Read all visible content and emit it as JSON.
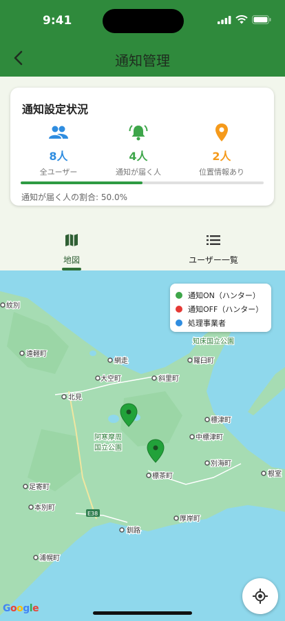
{
  "status_bar": {
    "time": "9:41"
  },
  "header": {
    "title": "通知管理"
  },
  "card": {
    "title": "通知設定状況",
    "stats": [
      {
        "value": "8人",
        "label": "全ユーザー",
        "icon": "group-icon",
        "color": "#2f8de0"
      },
      {
        "value": "4人",
        "label": "通知が届く人",
        "icon": "bell-icon",
        "color": "#3ea64a"
      },
      {
        "value": "2人",
        "label": "位置情報あり",
        "icon": "location-pin-icon",
        "color": "#f59a1b"
      }
    ],
    "progress": 0.5,
    "ratio_text": "通知が届く人の割合: 50.0%"
  },
  "tabs": [
    {
      "label": "地図",
      "icon": "map-icon",
      "selected": true
    },
    {
      "label": "ユーザー一覧",
      "icon": "list-icon",
      "selected": false
    }
  ],
  "legend": [
    {
      "label": "通知ON（ハンター）",
      "color": "#3ea64a"
    },
    {
      "label": "通知OFF（ハンター）",
      "color": "#e53935"
    },
    {
      "label": "処理事業者",
      "color": "#2f8de0"
    }
  ],
  "map_labels": {
    "monbetsu": "紋別",
    "engaru": "遠軽町",
    "abashiri": "網走",
    "ozora": "大空町",
    "shari": "斜里町",
    "shiretoko_park": "知床国立公園",
    "rausu": "羅臼町",
    "kitami": "北見",
    "shibetsu": "標津町",
    "nakashibetsu": "中標津町",
    "akan_park_1": "阿寒摩周",
    "akan_park_2": "国立公園",
    "betsukai": "別海町",
    "nemuro": "根室",
    "shibecha": "標茶町",
    "ashoro": "足寄町",
    "honbetsu": "本別町",
    "e38": "E38",
    "akkeshi": "厚岸町",
    "kushiro": "釧路",
    "urahoro": "浦幌町"
  },
  "google": "Google"
}
